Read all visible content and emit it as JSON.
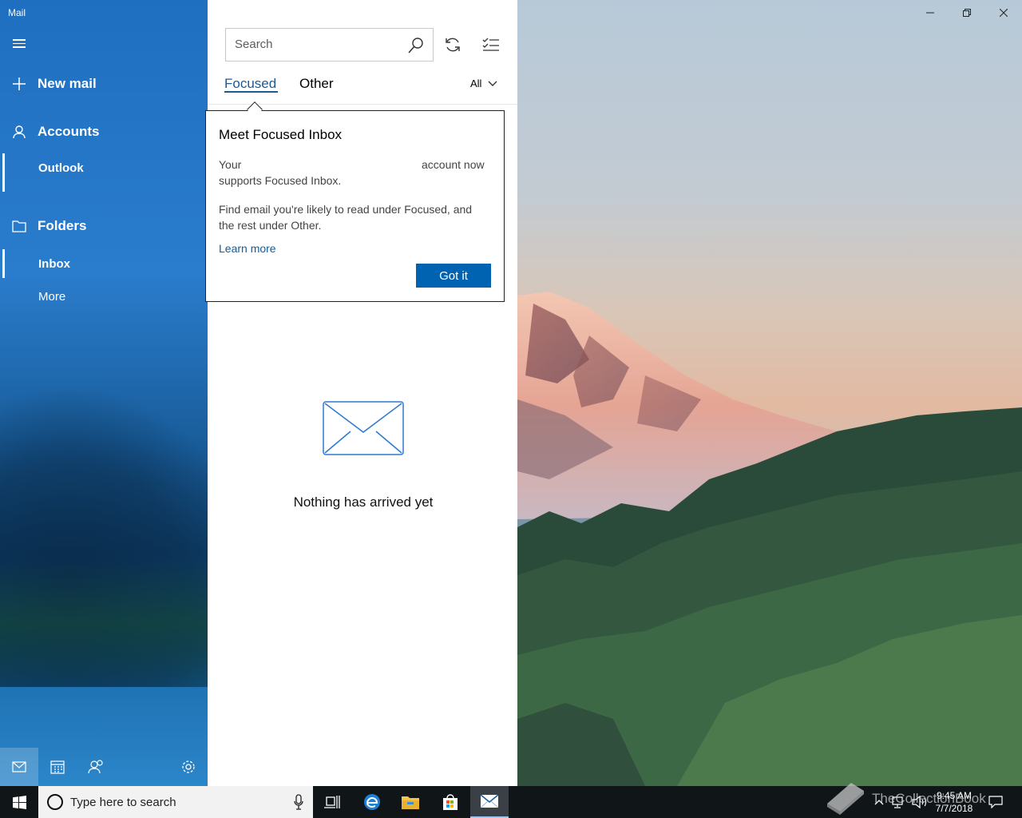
{
  "app": {
    "title": "Mail"
  },
  "nav": {
    "new_mail": "New mail",
    "accounts": "Accounts",
    "account_name": "Outlook",
    "folders": "Folders",
    "inbox": "Inbox",
    "more": "More"
  },
  "list": {
    "search_placeholder": "Search",
    "tabs": [
      "Focused",
      "Other"
    ],
    "filter": "All",
    "empty_message": "Nothing has arrived yet"
  },
  "popup": {
    "title": "Meet Focused Inbox",
    "line1_left": "Your",
    "line1_right": "account now",
    "line2": "supports Focused Inbox.",
    "para2_line1": "Find email you're likely to read under Focused, and",
    "para2_line2": "the rest under Other.",
    "link": "Learn more",
    "button": "Got it"
  },
  "taskbar": {
    "search_text": "Type here to search",
    "time": "9:45 AM",
    "date": "7/7/2018"
  },
  "watermark": {
    "text": "TheCollectionBook"
  }
}
